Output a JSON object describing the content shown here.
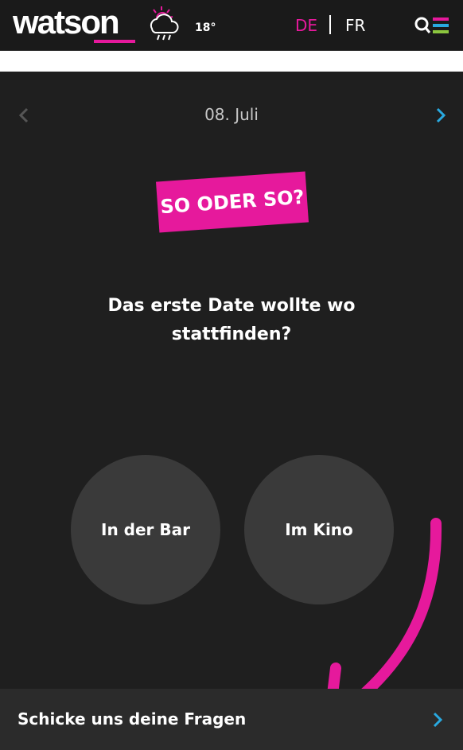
{
  "header": {
    "logo": "watson",
    "temperature": "18°",
    "lang_de": "DE",
    "lang_fr": "FR",
    "active_language": "DE"
  },
  "poll": {
    "date": "08. Juli",
    "badge": "SO ODER SO?",
    "question": "Das erste Date wollte wo stattfinden?",
    "option_a": "In der Bar",
    "option_b": "Im Kino"
  },
  "footer": {
    "cta": "Schicke uns deine Fragen"
  },
  "icons": {
    "weather": "cloud-rain-sun-icon",
    "menu": "search-menu-icon",
    "prev": "chevron-left-icon",
    "next": "chevron-right-icon"
  },
  "colors": {
    "accent": "#e6199c",
    "link_blue": "#29a9e0",
    "background": "#1f1f1f",
    "circle": "#3a3a3a"
  }
}
